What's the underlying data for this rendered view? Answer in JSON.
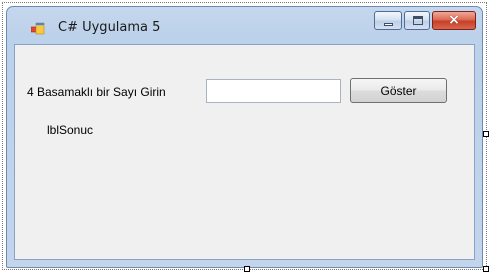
{
  "window": {
    "title": "C# Uygulama 5",
    "caption_buttons": {
      "minimize_glyph": "minimize-icon",
      "maximize_glyph": "maximize-icon",
      "close_glyph": "×"
    }
  },
  "form": {
    "prompt_label": "4 Basamaklı bir Sayı Girin",
    "number_input": {
      "value": "",
      "placeholder": ""
    },
    "show_button_label": "Göster",
    "result_label": "lblSonuc"
  },
  "colors": {
    "close_button": "#c6402a",
    "client_background": "#f0f0f0",
    "title_background": "#c5d7ee"
  }
}
